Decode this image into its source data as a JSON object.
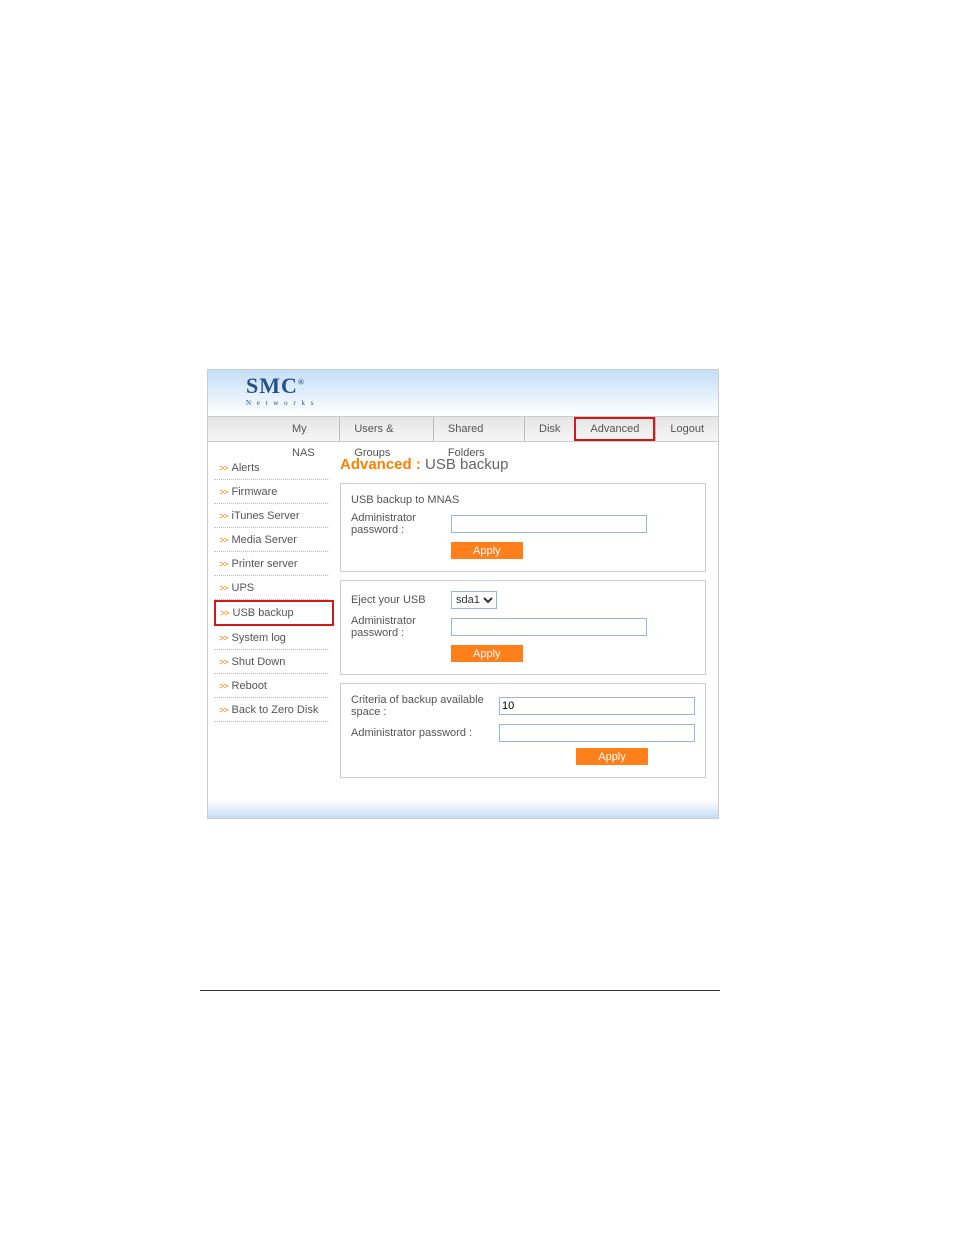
{
  "logo": {
    "line1": "SMC",
    "line2": "N e t w o r k s"
  },
  "nav": {
    "items": [
      {
        "label": "My NAS"
      },
      {
        "label": "Users & Groups"
      },
      {
        "label": "Shared Folders"
      },
      {
        "label": "Disk"
      },
      {
        "label": "Advanced",
        "active": true
      },
      {
        "label": "Logout"
      }
    ]
  },
  "sidebar": [
    {
      "label": "Alerts"
    },
    {
      "label": "Firmware"
    },
    {
      "label": "iTunes Server"
    },
    {
      "label": "Media Server"
    },
    {
      "label": "Printer server"
    },
    {
      "label": "UPS"
    },
    {
      "label": "USB backup",
      "active": true
    },
    {
      "label": "System log"
    },
    {
      "label": "Shut Down"
    },
    {
      "label": "Reboot"
    },
    {
      "label": "Back to Zero Disk"
    }
  ],
  "title": {
    "section": "Advanced :",
    "page": "USB backup"
  },
  "panel1": {
    "heading": "USB backup to MNAS",
    "pwd_label": "Administrator password :",
    "apply": "Apply"
  },
  "panel2": {
    "eject_label": "Eject your USB",
    "select_value": "sda1",
    "pwd_label": "Administrator password :",
    "apply": "Apply"
  },
  "panel3": {
    "criteria_label": "Criteria of backup available space :",
    "criteria_value": "10",
    "pwd_label": "Administrator password :",
    "apply": "Apply"
  }
}
